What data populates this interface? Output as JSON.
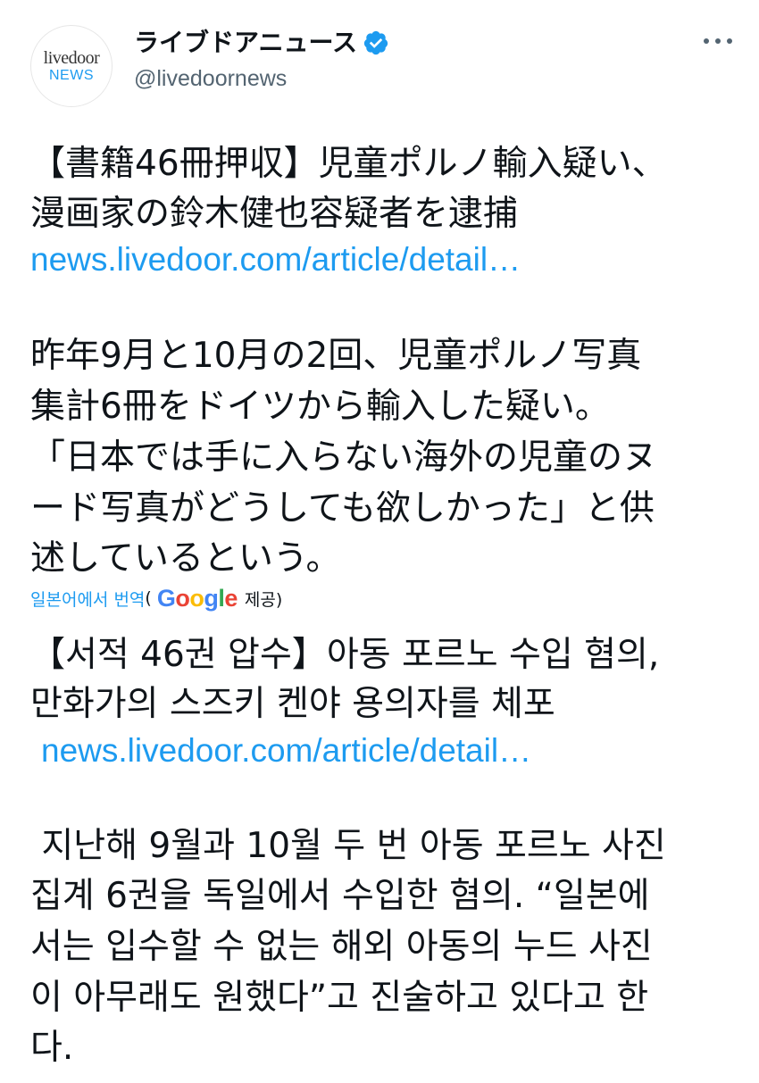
{
  "account": {
    "avatar_line1": "livedoor",
    "avatar_line2": "NEWS",
    "display_name": "ライブドアニュース",
    "handle": "@livedoornews"
  },
  "original": {
    "headline_lines": [
      "【書籍46冊押収】児童ポルノ輸入疑い、",
      "漫画家の鈴木健也容疑者を逮捕"
    ],
    "link": "news.livedoor.com/article/detail…",
    "body_lines": [
      "昨年9月と10月の2回、児童ポルノ写真",
      "集計6冊をドイツから輸入した疑い。",
      "「日本では手に入らない海外の児童のヌ",
      "ード写真がどうしても欲しかった」と供",
      "述しているという。"
    ]
  },
  "translation": {
    "from_label": "일본어에서 번역",
    "paren_open": "(",
    "google": [
      "G",
      "o",
      "o",
      "g",
      "l",
      "e"
    ],
    "provided": "제공)",
    "headline_lines": [
      "【서적 46권 압수】아동 포르노 수입 혐의,",
      "만화가의 스즈키 켄야 용의자를 체포"
    ],
    "link": "news.livedoor.com/article/detail…",
    "body_lines": [
      " 지난해 9월과 10월 두 번 아동 포르노 사진",
      "집계 6권을 독일에서 수입한 혐의. “일본에",
      "서는 입수할 수 없는 해외 아동의 누드 사진",
      "이 아무래도 원했다”고 진술하고 있다고 한",
      "다."
    ]
  },
  "colors": {
    "link": "#1d9bf0",
    "verified": "#1d9bf0",
    "text": "#0f1419",
    "secondary": "#536471"
  },
  "icons": {
    "verified": "verified-badge-icon",
    "more": "more-options-icon"
  }
}
